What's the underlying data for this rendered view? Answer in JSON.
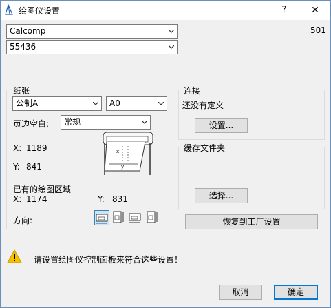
{
  "window": {
    "title": "绘图仪设置",
    "help": "?",
    "close": "✕"
  },
  "plotter": {
    "model": "Calcomp",
    "submodel": "55436",
    "code": "501"
  },
  "paper": {
    "group_title": "纸张",
    "standard": "公制A",
    "size": "A0",
    "margin_label": "页边空白:",
    "margin_value": "常规",
    "x_label": "X:",
    "x_value": "1189",
    "y_label": "Y:",
    "y_value": "841",
    "area_title": "已有的绘图区域",
    "area_x_label": "X:",
    "area_x_value": "1174",
    "area_y_label": "Y:",
    "area_y_value": "831",
    "orientation_label": "方向:"
  },
  "connection": {
    "group_title": "连接",
    "status": "还没有定义",
    "setup_button": "设置..."
  },
  "spool": {
    "group_title": "缓存文件夹",
    "select_button": "选择..."
  },
  "restore_button": "恢复到工厂设置",
  "warning": "请设置绘图仪控制面板来符合这些设置！",
  "footer": {
    "cancel": "取消",
    "ok": "确定"
  },
  "colors": {
    "accent": "#0078d7",
    "warning": "#f5c000"
  },
  "icons": [
    "plotter-app-icon",
    "chevron-down-icon",
    "printer-illustration-icon",
    "orientation-icons",
    "warning-icon"
  ]
}
